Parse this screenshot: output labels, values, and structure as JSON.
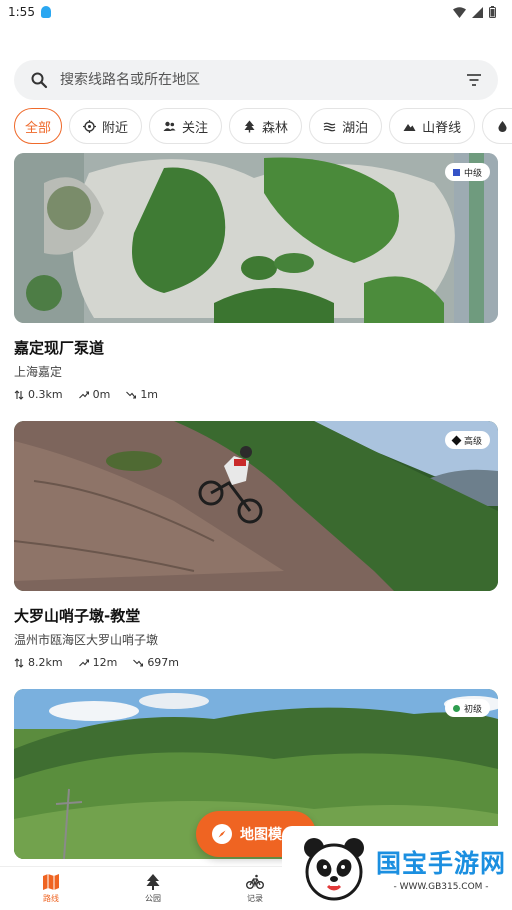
{
  "status": {
    "time": "1:55"
  },
  "search": {
    "placeholder": "搜索线路名或所在地区"
  },
  "categories": [
    {
      "label": "全部",
      "icon": "none"
    },
    {
      "label": "附近",
      "icon": "location-icon"
    },
    {
      "label": "关注",
      "icon": "people-icon"
    },
    {
      "label": "森林",
      "icon": "tree-icon"
    },
    {
      "label": "湖泊",
      "icon": "waves-icon"
    },
    {
      "label": "山脊线",
      "icon": "mountain-icon"
    },
    {
      "label": "溪流",
      "icon": "drop-icon"
    }
  ],
  "routes": [
    {
      "title": "嘉定现厂泵道",
      "location": "上海嘉定",
      "level": "中级",
      "level_color": "#3553c7",
      "distance": "0.3km",
      "ascent": "0m",
      "descent": "1m"
    },
    {
      "title": "大罗山哨子墩-教堂",
      "location": "温州市瓯海区大罗山哨子墩",
      "level": "高级",
      "level_color": "#111111",
      "distance": "8.2km",
      "ascent": "12m",
      "descent": "697m"
    },
    {
      "level": "初级",
      "level_color": "#2e9d4f"
    }
  ],
  "map_button": {
    "label": "地图模"
  },
  "nav": [
    {
      "label": "路线",
      "icon": "map-icon"
    },
    {
      "label": "公园",
      "icon": "tree-icon"
    },
    {
      "label": "记录",
      "icon": "bike-icon"
    }
  ],
  "watermark": {
    "title": "国宝手游网",
    "url": "- WWW.GB315.COM -"
  },
  "accent_color": "#ef6422"
}
